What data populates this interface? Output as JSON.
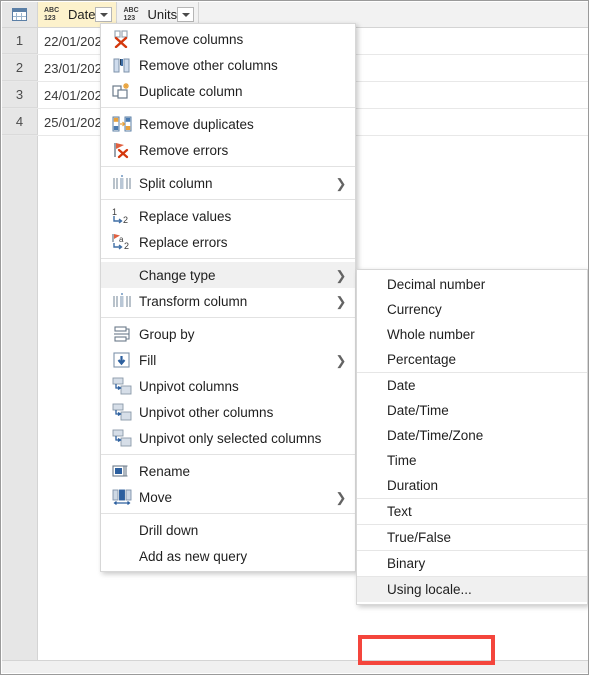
{
  "grid": {
    "corner_icon": "table-grid-icon",
    "columns": [
      {
        "name": "Date",
        "type_icon_top": "ABC",
        "type_icon_bottom": "123",
        "selected": true,
        "filter_icon": "chevron-down-icon"
      },
      {
        "name": "Units",
        "type_icon_top": "ABC",
        "type_icon_bottom": "123",
        "selected": false,
        "filter_icon": "chevron-down-icon"
      }
    ],
    "rows": [
      {
        "num": "1",
        "date": "22/01/202",
        "units": ""
      },
      {
        "num": "2",
        "date": "23/01/202",
        "units": ""
      },
      {
        "num": "3",
        "date": "24/01/202",
        "units": ""
      },
      {
        "num": "4",
        "date": "25/01/202",
        "units": ""
      }
    ]
  },
  "context_menu": {
    "items": [
      {
        "label": "Remove columns",
        "icon": "remove-columns-icon",
        "submenu": false,
        "sep_after": false
      },
      {
        "label": "Remove other columns",
        "icon": "remove-other-columns-icon",
        "submenu": false,
        "sep_after": false
      },
      {
        "label": "Duplicate column",
        "icon": "duplicate-column-icon",
        "submenu": false,
        "sep_after": true
      },
      {
        "label": "Remove duplicates",
        "icon": "remove-duplicates-icon",
        "submenu": false,
        "sep_after": false
      },
      {
        "label": "Remove errors",
        "icon": "remove-errors-icon",
        "submenu": false,
        "sep_after": true
      },
      {
        "label": "Split column",
        "icon": "split-column-icon",
        "submenu": true,
        "sep_after": true
      },
      {
        "label": "Replace values",
        "icon": "replace-values-icon",
        "submenu": false,
        "sep_after": false
      },
      {
        "label": "Replace errors",
        "icon": "replace-errors-icon",
        "submenu": false,
        "sep_after": true
      },
      {
        "label": "Change type",
        "icon": "none",
        "submenu": true,
        "sep_after": false,
        "hovered": true
      },
      {
        "label": "Transform column",
        "icon": "transform-column-icon",
        "submenu": true,
        "sep_after": true
      },
      {
        "label": "Group by",
        "icon": "group-by-icon",
        "submenu": false,
        "sep_after": false
      },
      {
        "label": "Fill",
        "icon": "fill-icon",
        "submenu": true,
        "sep_after": false
      },
      {
        "label": "Unpivot columns",
        "icon": "unpivot-columns-icon",
        "submenu": false,
        "sep_after": false
      },
      {
        "label": "Unpivot other columns",
        "icon": "unpivot-other-columns-icon",
        "submenu": false,
        "sep_after": false
      },
      {
        "label": "Unpivot only selected columns",
        "icon": "unpivot-selected-columns-icon",
        "submenu": false,
        "sep_after": true
      },
      {
        "label": "Rename",
        "icon": "rename-icon",
        "submenu": false,
        "sep_after": false
      },
      {
        "label": "Move",
        "icon": "move-icon",
        "submenu": true,
        "sep_after": true
      },
      {
        "label": "Drill down",
        "icon": "none",
        "submenu": false,
        "sep_after": false
      },
      {
        "label": "Add as new query",
        "icon": "none",
        "submenu": false,
        "sep_after": false
      }
    ]
  },
  "change_type_submenu": {
    "items": [
      {
        "label": "Decimal number",
        "sep_after": false
      },
      {
        "label": "Currency",
        "sep_after": false
      },
      {
        "label": "Whole number",
        "sep_after": false
      },
      {
        "label": "Percentage",
        "sep_after": true
      },
      {
        "label": "Date",
        "sep_after": false
      },
      {
        "label": "Date/Time",
        "sep_after": false
      },
      {
        "label": "Date/Time/Zone",
        "sep_after": false
      },
      {
        "label": "Time",
        "sep_after": false
      },
      {
        "label": "Duration",
        "sep_after": true
      },
      {
        "label": "Text",
        "sep_after": true
      },
      {
        "label": "True/False",
        "sep_after": true
      },
      {
        "label": "Binary",
        "sep_after": true
      },
      {
        "label": "Using locale...",
        "sep_after": false,
        "hovered": true,
        "highlighted": true
      }
    ]
  },
  "annotation": {
    "highlight_color": "#f4453c",
    "target_label": "Using locale..."
  }
}
